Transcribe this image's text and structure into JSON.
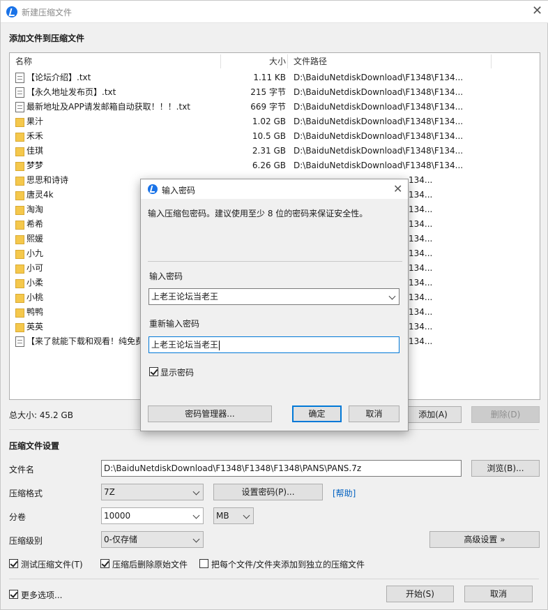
{
  "window": {
    "title": "新建压缩文件",
    "close_icon": "close-icon"
  },
  "files_section": {
    "title": "添加文件到压缩文件",
    "columns": {
      "name": "名称",
      "size": "大小",
      "path": "文件路径"
    },
    "rows": [
      {
        "type": "file",
        "name": "【论坛介绍】.txt",
        "size": "1.11 KB",
        "path": "D:\\BaiduNetdiskDownload\\F1348\\F134..."
      },
      {
        "type": "file",
        "name": "【永久地址发布页】.txt",
        "size": "215 字节",
        "path": "D:\\BaiduNetdiskDownload\\F1348\\F134..."
      },
      {
        "type": "file",
        "name": "最新地址及APP请发邮箱自动获取！！！.txt",
        "size": "669 字节",
        "path": "D:\\BaiduNetdiskDownload\\F1348\\F134..."
      },
      {
        "type": "folder",
        "name": "果汁",
        "size": "1.02 GB",
        "path": "D:\\BaiduNetdiskDownload\\F1348\\F134..."
      },
      {
        "type": "folder",
        "name": "禾禾",
        "size": "10.5 GB",
        "path": "D:\\BaiduNetdiskDownload\\F1348\\F134..."
      },
      {
        "type": "folder",
        "name": "佳琪",
        "size": "2.31 GB",
        "path": "D:\\BaiduNetdiskDownload\\F1348\\F134..."
      },
      {
        "type": "folder",
        "name": "梦梦",
        "size": "6.26 GB",
        "path": "D:\\BaiduNetdiskDownload\\F1348\\F134..."
      },
      {
        "type": "folder",
        "name": "思思和诗诗",
        "size": "",
        "path": ""
      },
      {
        "type": "folder",
        "name": "唐灵4k",
        "size": "",
        "path": ""
      },
      {
        "type": "folder",
        "name": "淘淘",
        "size": "",
        "path": ""
      },
      {
        "type": "folder",
        "name": "希希",
        "size": "",
        "path": ""
      },
      {
        "type": "folder",
        "name": "熙媛",
        "size": "",
        "path": ""
      },
      {
        "type": "folder",
        "name": "小九",
        "size": "",
        "path": ""
      },
      {
        "type": "folder",
        "name": "小可",
        "size": "",
        "path": ""
      },
      {
        "type": "folder",
        "name": "小柔",
        "size": "",
        "path": ""
      },
      {
        "type": "folder",
        "name": "小桃",
        "size": "",
        "path": ""
      },
      {
        "type": "folder",
        "name": "鸭鸭",
        "size": "",
        "path": ""
      },
      {
        "type": "folder",
        "name": "英英",
        "size": "",
        "path": ""
      },
      {
        "type": "file",
        "name": "【来了就能下载和观看！纯免费",
        "size": "",
        "path": ""
      }
    ],
    "path_tail": "134...",
    "total_label": "总大小: 45.2 GB",
    "add_button": "添加(A)",
    "delete_button": "删除(D)"
  },
  "settings": {
    "title": "压缩文件设置",
    "filename_label": "文件名",
    "filename_value": "D:\\BaiduNetdiskDownload\\F1348\\F1348\\F1348\\PANS\\PANS.7z",
    "browse_button": "浏览(B)...",
    "format_label": "压缩格式",
    "format_value": "7Z",
    "set_password_button": "设置密码(P)...",
    "help_link": "[帮助]",
    "split_label": "分卷",
    "split_value": "10000",
    "split_unit": "MB",
    "level_label": "压缩级别",
    "level_value": "0-仅存储",
    "advanced_button": "高级设置 »",
    "test_checkbox": "测试压缩文件(T)",
    "test_checked": true,
    "delete_checkbox": "压缩后删除原始文件",
    "delete_checked": true,
    "separate_checkbox": "把每个文件/文件夹添加到独立的压缩文件",
    "separate_checked": false,
    "more_options": "更多选项...",
    "more_checked": true,
    "start_button": "开始(S)",
    "cancel_button": "取消"
  },
  "password_dialog": {
    "title": "输入密码",
    "description": "输入压缩包密码。建议使用至少 8 位的密码来保证安全性。",
    "password_label": "输入密码",
    "password_value": "上老王论坛当老王",
    "confirm_label": "重新输入密码",
    "confirm_value": "上老王论坛当老王",
    "show_password": "显示密码",
    "show_checked": true,
    "manager_button": "密码管理器...",
    "ok_button": "确定",
    "cancel_button": "取消"
  }
}
